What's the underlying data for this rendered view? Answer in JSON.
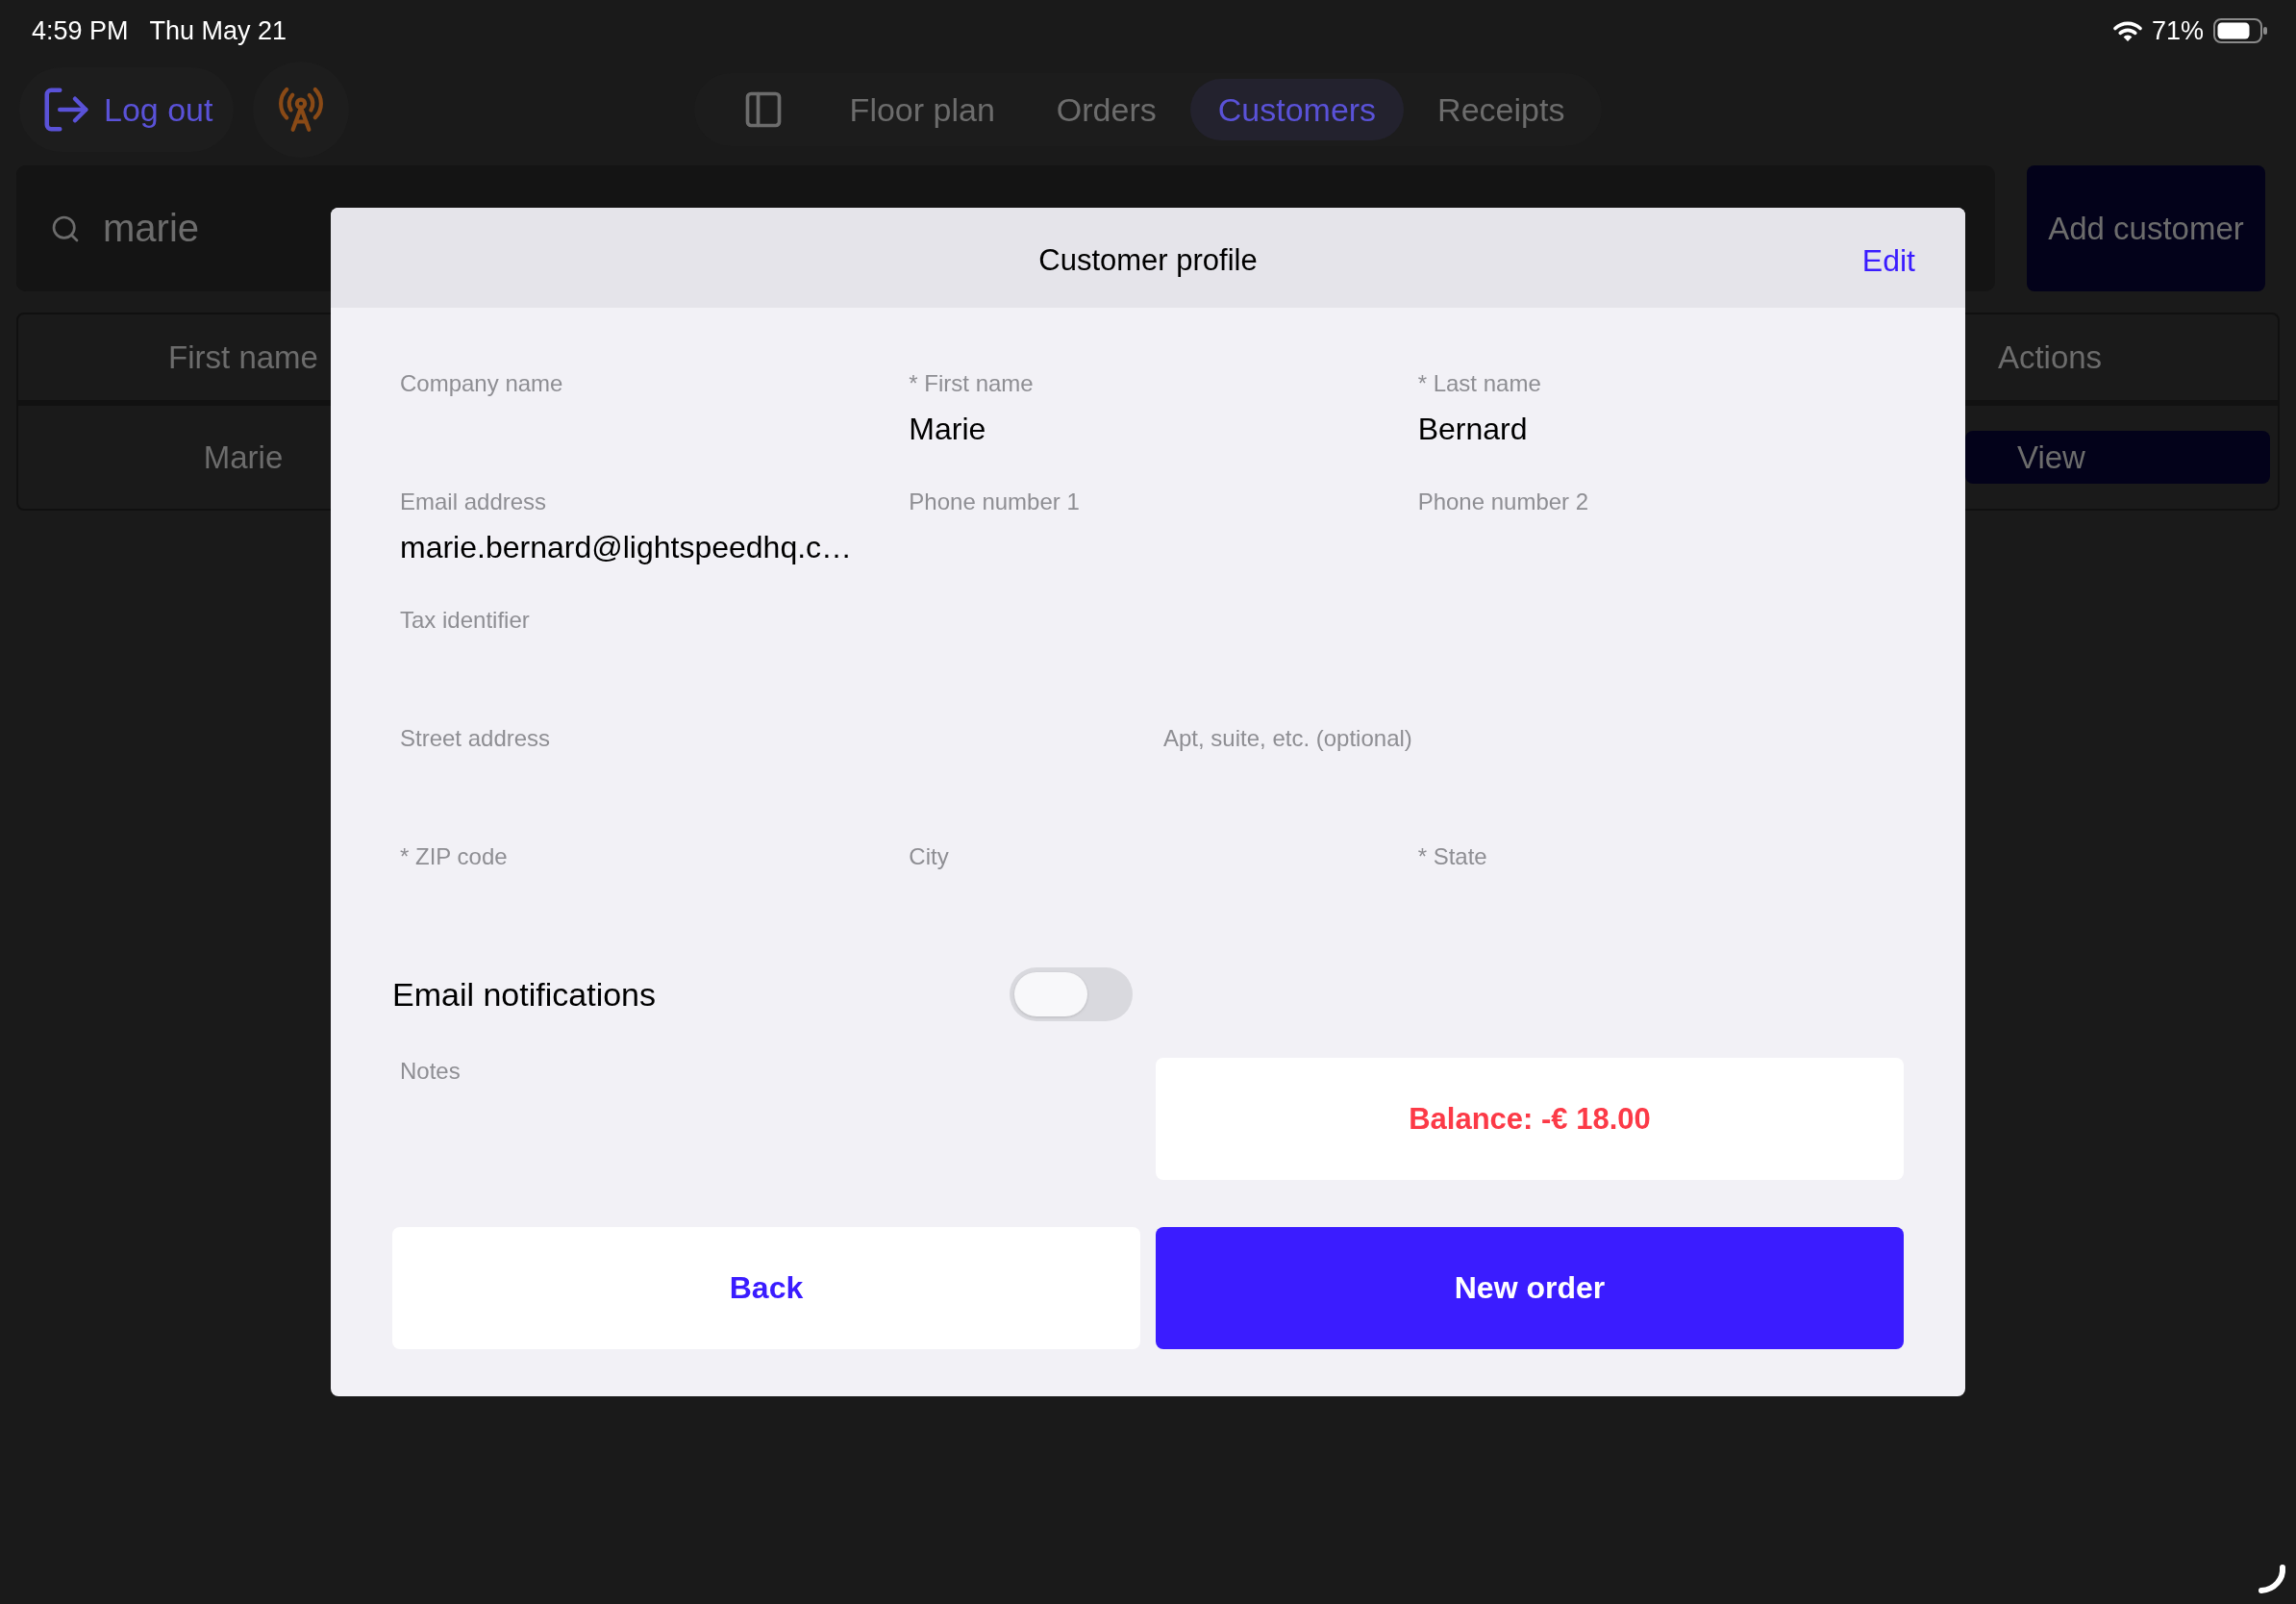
{
  "status_bar": {
    "time": "4:59 PM",
    "date": "Thu May 21",
    "battery": "71%"
  },
  "toolbar": {
    "logout_button": "Log out",
    "tabs": [
      {
        "label": "Floor plan",
        "selected": false
      },
      {
        "label": "Orders",
        "selected": false
      },
      {
        "label": "Customers",
        "selected": true
      },
      {
        "label": "Receipts",
        "selected": false
      }
    ]
  },
  "search": {
    "value": "marie"
  },
  "add_customer_button": "Add customer",
  "table": {
    "columns": [
      "First name",
      "Actions"
    ],
    "rows": [
      {
        "first_name": "Marie",
        "action": "View"
      }
    ]
  },
  "dialog": {
    "title": "Customer profile",
    "edit_link": "Edit",
    "field_rows": [
      {
        "fields": [
          {
            "label": "Company name"
          },
          {
            "label": "* First name",
            "value": "Marie"
          },
          {
            "label": "* Last name",
            "value": "Bernard"
          }
        ]
      },
      {
        "fields": [
          {
            "label": "Email address",
            "value": "marie.bernard@lightspeedhq.c…"
          },
          {
            "label": "Phone number 1"
          },
          {
            "label": "Phone number 2"
          }
        ]
      },
      {
        "fields": [
          {
            "label": "Tax identifier"
          }
        ]
      },
      {
        "fields": [
          {
            "label": "Street address"
          },
          {
            "label": "Apt, suite, etc. (optional)"
          }
        ]
      },
      {
        "fields": [
          {
            "label": "* ZIP code"
          },
          {
            "label": "City"
          },
          {
            "label": "* State"
          }
        ]
      }
    ],
    "email_notifications": {
      "label": "Email notifications",
      "on": false
    },
    "notes": {
      "label": "Notes"
    },
    "balance": "Balance: -€ 18.00",
    "buttons": [
      {
        "label": "Back",
        "kind": "secondary"
      },
      {
        "label": "New order",
        "kind": "primary"
      }
    ]
  }
}
